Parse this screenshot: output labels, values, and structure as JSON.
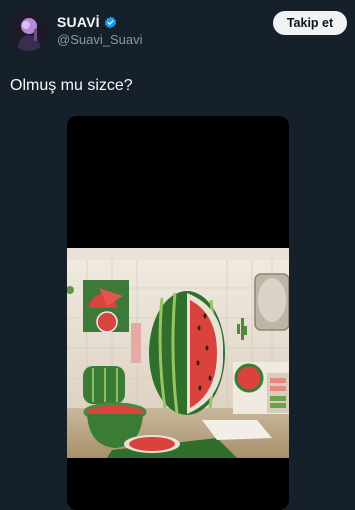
{
  "user": {
    "display_name": "SUAVİ",
    "handle": "@Suavi_Suavi",
    "verified": true,
    "verified_color": "#1d9bf0"
  },
  "actions": {
    "follow_label": "Takip et"
  },
  "tweet": {
    "text": "Olmuş mu sizce?"
  },
  "media": {
    "icon": "photo",
    "description_icon": "watermelon-bathroom-image"
  },
  "colors": {
    "background": "#15202b",
    "text": "#f7f9f9",
    "secondary_text": "#8b98a5",
    "button_bg": "#eff3f4"
  }
}
